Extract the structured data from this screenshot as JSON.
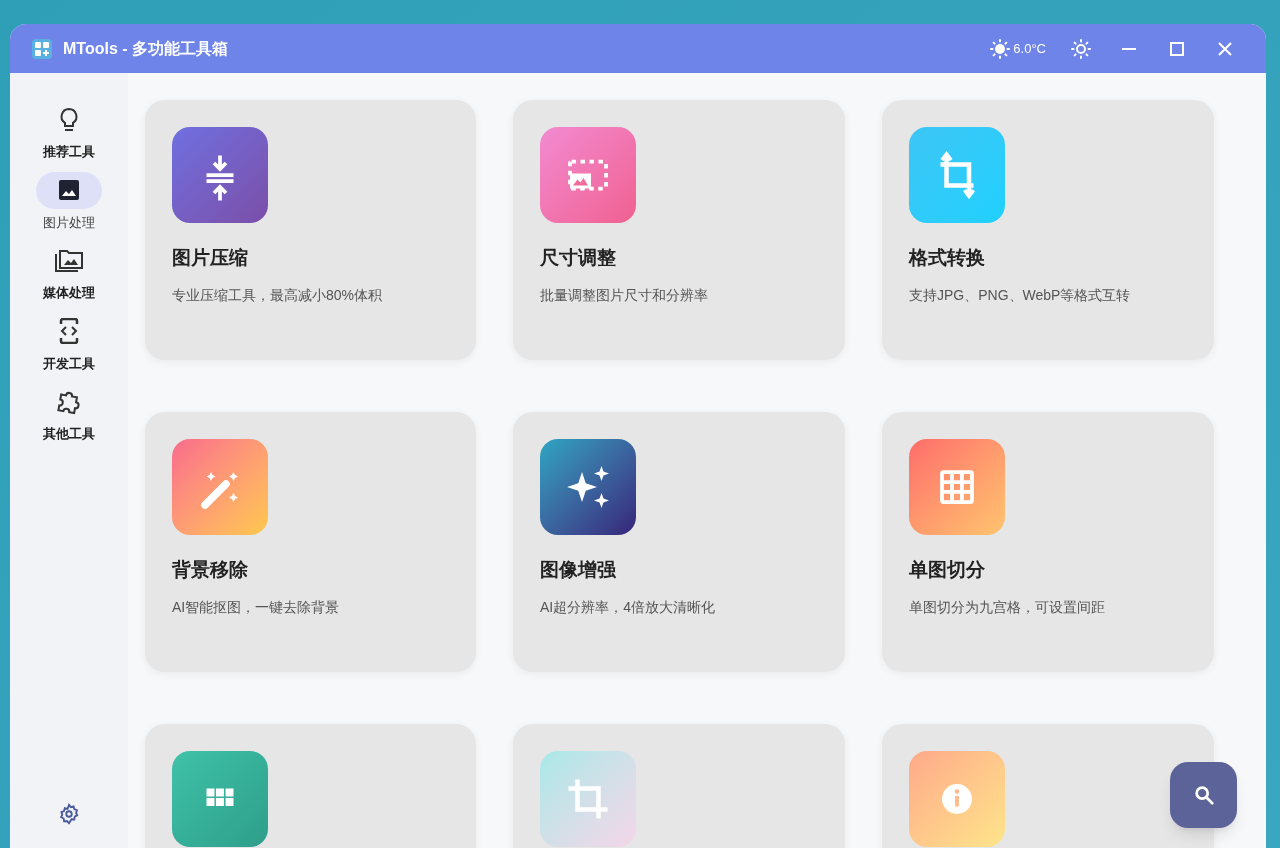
{
  "window": {
    "title": "MTools - 多功能工具箱",
    "weather": "6.0°C"
  },
  "sidebar": {
    "items": [
      {
        "label": "推荐工具",
        "kind": "bulb",
        "selected": false
      },
      {
        "label": "图片处理",
        "kind": "image",
        "selected": true
      },
      {
        "label": "媒体处理",
        "kind": "gallery",
        "selected": false
      },
      {
        "label": "开发工具",
        "kind": "code",
        "selected": false
      },
      {
        "label": "其他工具",
        "kind": "puzzle",
        "selected": false
      }
    ]
  },
  "cards": [
    {
      "kind": "compress",
      "title": "图片压缩",
      "description": "专业压缩工具，最高减小80%体积"
    },
    {
      "kind": "resize",
      "title": "尺寸调整",
      "description": "批量调整图片尺寸和分辨率"
    },
    {
      "kind": "convert",
      "title": "格式转换",
      "description": "支持JPG、PNG、WebP等格式互转"
    },
    {
      "kind": "wand",
      "title": "背景移除",
      "description": "AI智能抠图，一键去除背景"
    },
    {
      "kind": "sparkle",
      "title": "图像增强",
      "description": "AI超分辨率，4倍放大清晰化"
    },
    {
      "kind": "grid",
      "title": "单图切分",
      "description": "单图切分为九宫格，可设置间距"
    },
    {
      "kind": "tiles"
    },
    {
      "kind": "crop"
    },
    {
      "kind": "info"
    }
  ]
}
